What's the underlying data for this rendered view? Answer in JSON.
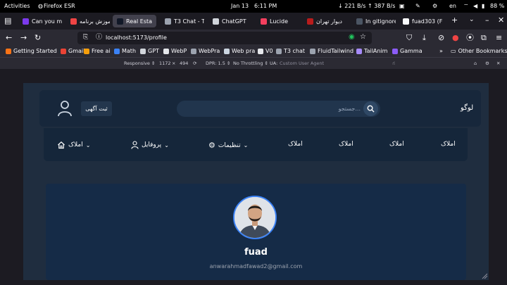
{
  "system_bar": {
    "activities": "Activities",
    "app": "Firefox ESR",
    "date": "Jan 13",
    "time": "6:11 PM",
    "net": "↓ 221 B/s ↑ 387 B/s",
    "lang": "en",
    "battery": "88 %"
  },
  "tabs": [
    {
      "label": "Can you m",
      "color": "#7c3aed"
    },
    {
      "label": "آموزش برنامه",
      "color": "#ef4444"
    },
    {
      "label": "Real Esta",
      "color": "#111827"
    },
    {
      "label": "T3 Chat - Th",
      "color": "#9ca3af"
    },
    {
      "label": "ChatGPT",
      "color": "#d1d5db"
    },
    {
      "label": "Lucide",
      "color": "#f43f5e"
    },
    {
      "label": "دیوار تهران",
      "color": "#b91c1c"
    },
    {
      "label": "In gitignore",
      "color": "#4b5563"
    },
    {
      "label": "fuad303 (Fu",
      "color": "#f9fafb"
    }
  ],
  "url": "localhost:5173/profile",
  "bookmarks": [
    {
      "label": "Getting Started",
      "color": "#f97316"
    },
    {
      "label": "Gmail",
      "color": "#ea4335"
    },
    {
      "label": "Free ai",
      "color": "#f59e0b"
    },
    {
      "label": "Math",
      "color": "#3b82f6"
    },
    {
      "label": "GPT",
      "color": "#d1d5db"
    },
    {
      "label": "WebP",
      "color": "#e5e7eb"
    },
    {
      "label": "WebPra",
      "color": "#9ca3af"
    },
    {
      "label": "Web pra",
      "color": "#cbd5e1"
    },
    {
      "label": "V0",
      "color": "#e5e7eb"
    },
    {
      "label": "T3 chat",
      "color": "#9ca3af"
    },
    {
      "label": "FluidTailwind",
      "color": "#9ca3af"
    },
    {
      "label": "TailAnim",
      "color": "#a78bfa"
    },
    {
      "label": "Gamma",
      "color": "#8b5cf6"
    }
  ],
  "other_bookmarks": "Other Bookmarks",
  "rdm": {
    "responsive": "Responsive ⇕",
    "width": "1172",
    "times": "×",
    "height": "494",
    "dpr": "DPR: 1.5 ⇕",
    "throttle": "No Throttling ⇕",
    "ua_label": "UA:",
    "ua_placeholder": "Custom User Agent"
  },
  "site": {
    "post_ad": "ثبت آگهی",
    "search_placeholder": "جستجو...",
    "logo": "لوگو",
    "menu": [
      {
        "label": "املاک",
        "dropdown": true,
        "icon": "home-icon"
      },
      {
        "label": "پروفایل",
        "dropdown": true,
        "icon": "user-icon"
      },
      {
        "label": "تنظیمات",
        "dropdown": true,
        "icon": "gear-icon"
      },
      {
        "label": "املاک"
      },
      {
        "label": "املاک"
      },
      {
        "label": "املاک"
      },
      {
        "label": "املاک"
      }
    ],
    "profile": {
      "name": "fuad",
      "email": "anwarahmadfawad2@gmail.com"
    }
  }
}
